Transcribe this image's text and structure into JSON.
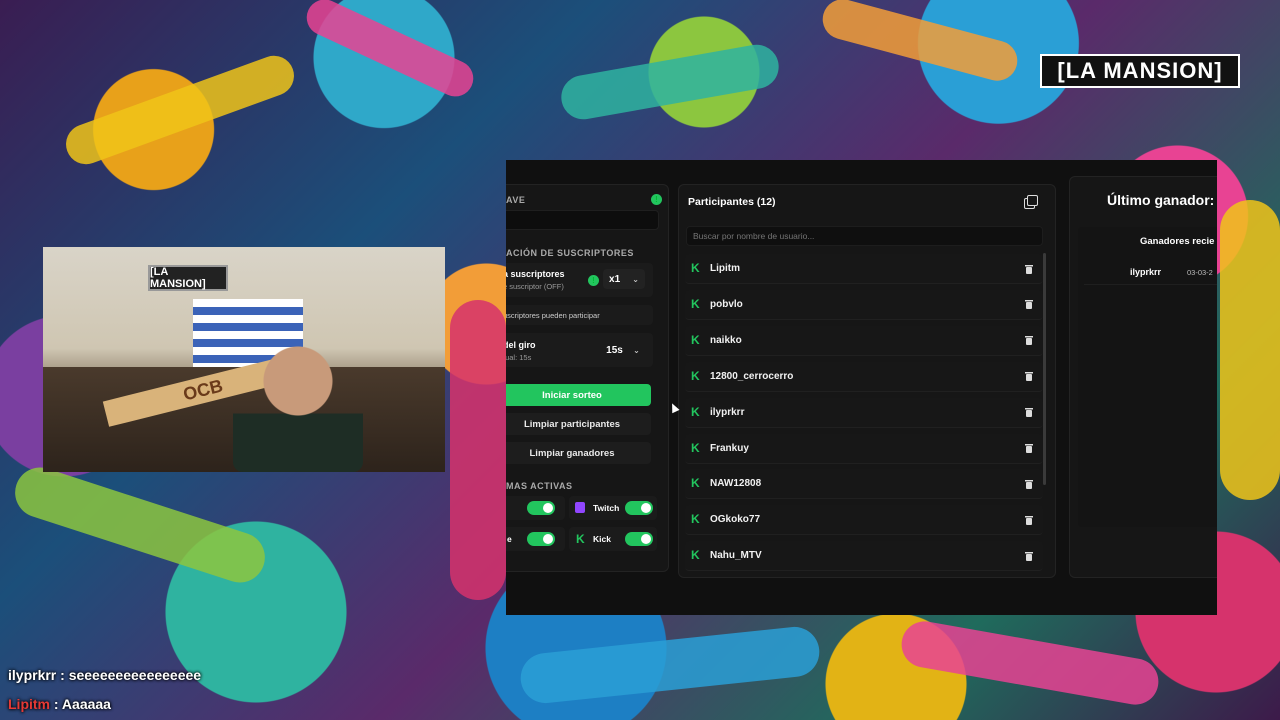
{
  "overlay": {
    "logo": "[LA MANSION]",
    "chat": [
      {
        "user": "ilyprkrr",
        "sep": " : ",
        "message": "seeeeeeeeeeeeeeee"
      },
      {
        "user": "Lipitm",
        "sep": " : ",
        "message": "Aaaaaa"
      }
    ]
  },
  "webcam": {
    "wall_sign": "[LA MANSION]",
    "cigar_brand": "OCB"
  },
  "left": {
    "key_section": "AVE",
    "subs_section": "ACIÓN DE SUSCRIPTORES",
    "subs_title": "a suscriptores",
    "subs_sub": "e suscriptor (OFF)",
    "multiplier": "x1",
    "only_subs": "uscriptores pueden participar",
    "spin_title": "del giro",
    "spin_sub": "tual: 15s",
    "spin_value": "15s",
    "start_button": "Iniciar sorteo",
    "clear_participants": "Limpiar participantes",
    "clear_winners": "Limpiar ganadores",
    "platforms_section": "MAS ACTIVAS",
    "platform_twitch": "Twitch",
    "platform_kick": "Kick",
    "platform_partial": "e"
  },
  "participants": {
    "title": "Participantes (12)",
    "search_placeholder": "Buscar por nombre de usuario...",
    "items": [
      "Lipitm",
      "pobvlo",
      "naikko",
      "12800_cerrocerro",
      "ilyprkrr",
      "Frankuy",
      "NAW12808",
      "OGkoko77",
      "Nahu_MTV"
    ]
  },
  "winner": {
    "title": "Último ganador:",
    "recent_header": "Ganadores recie",
    "recent": [
      {
        "name": "ilyprkrr",
        "date": "03-03-2"
      }
    ]
  },
  "colors": {
    "accent": "#22c55e",
    "panel": "#161616",
    "bg": "#101010"
  }
}
